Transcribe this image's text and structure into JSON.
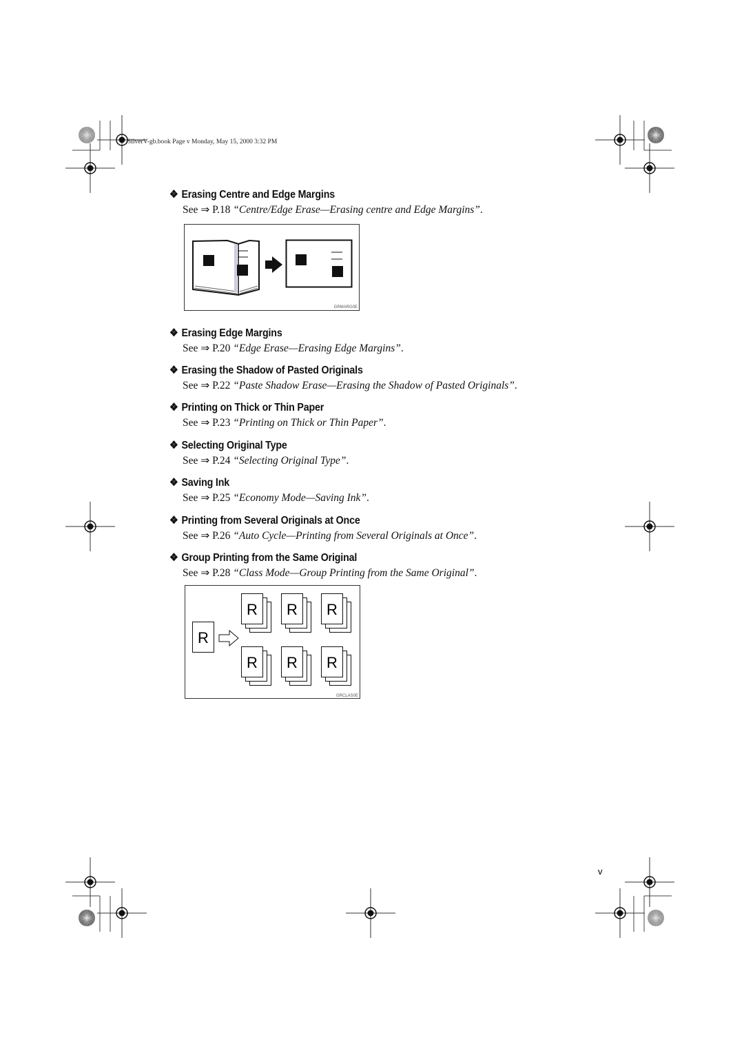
{
  "header": {
    "text": "SilverV-gb.book  Page v  Monday, May 15, 2000  3:32 PM"
  },
  "sections": [
    {
      "title": "Erasing Centre and Edge Margins",
      "see": "See",
      "arrow": "⇒",
      "page": "P.18",
      "ref": "“Centre/Edge Erase—Erasing centre and Edge Margins”"
    },
    {
      "title": "Erasing Edge Margins",
      "see": "See",
      "arrow": "⇒",
      "page": "P.20",
      "ref": "“Edge Erase—Erasing Edge Margins”"
    },
    {
      "title": "Erasing the Shadow of Pasted Originals",
      "see": "See",
      "arrow": "⇒",
      "page": "P.22",
      "ref": "“Paste Shadow Erase—Erasing the Shadow of Pasted Originals”"
    },
    {
      "title": "Printing on Thick or Thin Paper",
      "see": "See",
      "arrow": "⇒",
      "page": "P.23",
      "ref": "“Printing on Thick or Thin Paper”"
    },
    {
      "title": "Selecting Original Type",
      "see": "See",
      "arrow": "⇒",
      "page": "P.24",
      "ref": "“Selecting Original Type”"
    },
    {
      "title": "Saving Ink",
      "see": "See",
      "arrow": "⇒",
      "page": "P.25",
      "ref": "“Economy Mode—Saving Ink”"
    },
    {
      "title": "Printing from Several Originals at Once",
      "see": "See",
      "arrow": "⇒",
      "page": "P.26",
      "ref": "“Auto Cycle—Printing from Several Originals at Once”"
    },
    {
      "title": "Group Printing from the Same Original",
      "see": "See",
      "arrow": "⇒",
      "page": "P.28",
      "ref": "“Class Mode—Group Printing from the Same Original”"
    }
  ],
  "bullet": "❖",
  "figures": {
    "margin_code": "GRMARG0E",
    "class_code": "GRCLAS0E",
    "letter": "R"
  },
  "page_number": "v"
}
